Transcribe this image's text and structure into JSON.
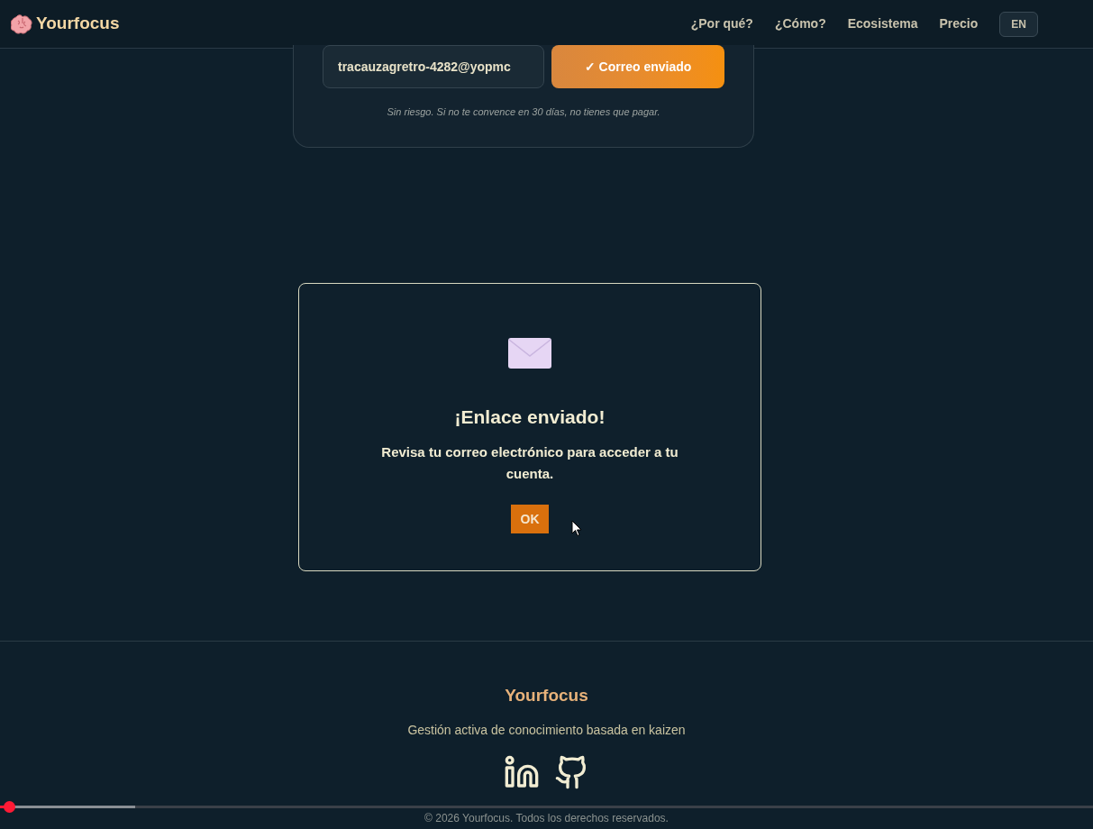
{
  "header": {
    "brand": "Yourfocus",
    "nav": [
      {
        "label": "¿Por qué?"
      },
      {
        "label": "¿Cómo?"
      },
      {
        "label": "Ecosistema"
      },
      {
        "label": "Precio"
      }
    ],
    "language_button": "EN"
  },
  "signup": {
    "email_value": "tracauzagretro-4282@yopmc",
    "submit_button": "✓ Correo enviado",
    "note": "Sin riesgo. Si no te convence en 30 días, no tienes que pagar."
  },
  "dialog": {
    "title": "¡Enlace enviado!",
    "message": "Revisa tu correo electrónico para acceder a tu cuenta.",
    "ok_button": "OK"
  },
  "footer": {
    "brand": "Yourfocus",
    "tagline": "Gestión activa de conocimiento basada en kaizen",
    "copyright": "© 2026 Yourfocus. Todos los derechos reservados."
  },
  "video_progress": {
    "level": 0.008
  }
}
